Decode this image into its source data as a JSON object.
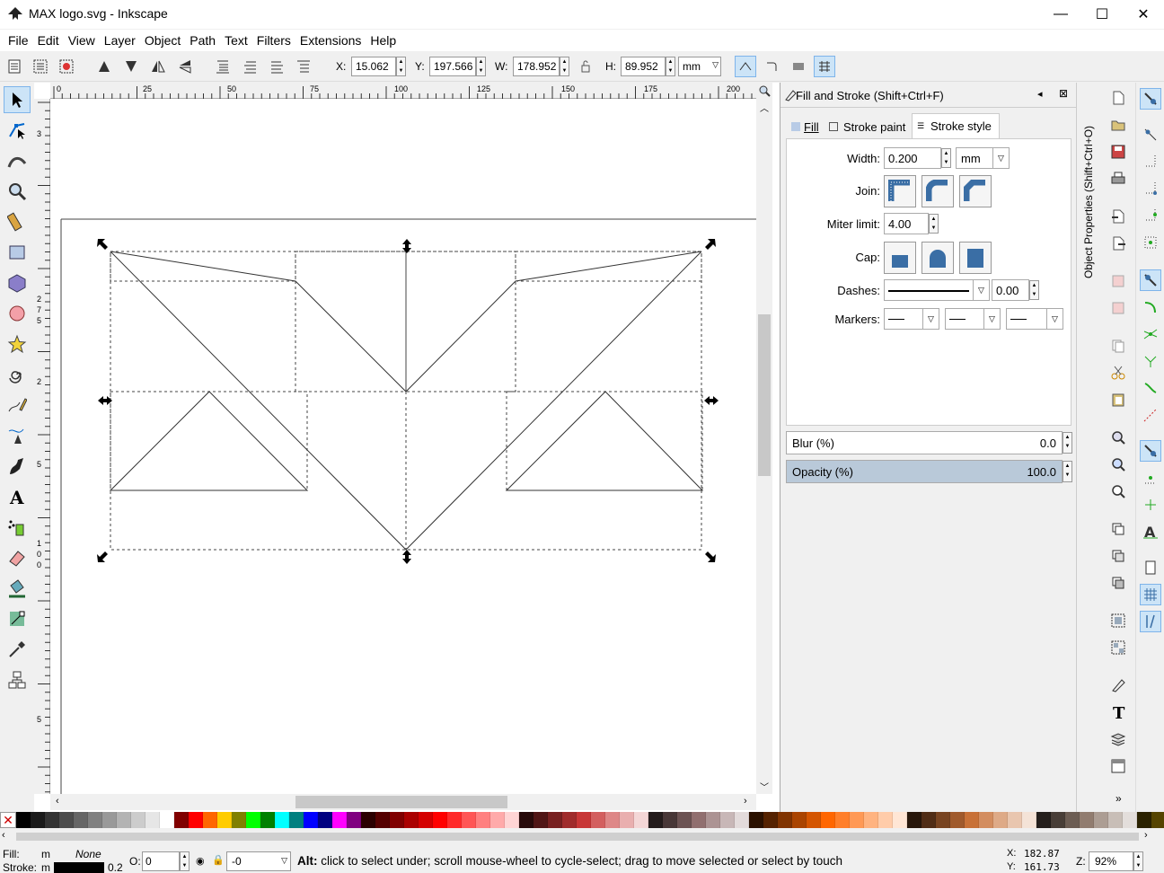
{
  "window": {
    "title": "MAX logo.svg - Inkscape",
    "minimize": "—",
    "maximize": "☐",
    "close": "✕"
  },
  "menu": [
    "File",
    "Edit",
    "View",
    "Layer",
    "Object",
    "Path",
    "Text",
    "Filters",
    "Extensions",
    "Help"
  ],
  "toolbar": {
    "x_label": "X:",
    "x_value": "15.062",
    "y_label": "Y:",
    "y_value": "197.566",
    "w_label": "W:",
    "w_value": "178.952",
    "h_label": "H:",
    "h_value": "89.952",
    "unit": "mm"
  },
  "ruler": {
    "h_ticks": [
      "0",
      "25",
      "50",
      "75",
      "100",
      "125",
      "150",
      "175",
      "200"
    ],
    "v_ticks": [
      "3",
      "2",
      "7",
      "5",
      "2",
      "5",
      "1",
      "0",
      "0",
      "5"
    ]
  },
  "dialog": {
    "title": "Fill and Stroke (Shift+Ctrl+F)",
    "tabs": [
      "Fill",
      "Stroke paint",
      "Stroke style"
    ],
    "active_tab": "Stroke style",
    "width_label": "Width:",
    "width_value": "0.200",
    "width_unit": "mm",
    "join_label": "Join:",
    "miter_label": "Miter limit:",
    "miter_value": "4.00",
    "cap_label": "Cap:",
    "dashes_label": "Dashes:",
    "dashes_offset": "0.00",
    "markers_label": "Markers:",
    "blur_label": "Blur (%)",
    "blur_value": "0.0",
    "opacity_label": "Opacity (%)",
    "opacity_value": "100.0",
    "opacity_fraction": 1.0
  },
  "side_tab": {
    "label": "Object Properties (Shift+Ctrl+O)"
  },
  "palette": {
    "none_swatch": "✕",
    "colors": [
      "#000000",
      "#1a1a1a",
      "#333333",
      "#4d4d4d",
      "#666666",
      "#808080",
      "#999999",
      "#b3b3b3",
      "#cccccc",
      "#e6e6e6",
      "#ffffff",
      "#800000",
      "#ff0000",
      "#ff6600",
      "#ffcc00",
      "#808000",
      "#00ff00",
      "#008000",
      "#00ffff",
      "#008080",
      "#0000ff",
      "#000080",
      "#ff00ff",
      "#800080",
      "#2b0000",
      "#550000",
      "#800000",
      "#aa0000",
      "#d40000",
      "#ff0000",
      "#ff2a2a",
      "#ff5555",
      "#ff8080",
      "#ffaaaa",
      "#ffd5d5",
      "#280b0b",
      "#501616",
      "#782121",
      "#a02c2c",
      "#c83737",
      "#d35f5f",
      "#de8787",
      "#e9afaf",
      "#f4d7d7",
      "#241c1c",
      "#483737",
      "#6c5353",
      "#916f6f",
      "#ac9393",
      "#c8b7b7",
      "#e3dbdb",
      "#2b1100",
      "#552200",
      "#803300",
      "#aa4400",
      "#d45500",
      "#ff6600",
      "#ff7f2a",
      "#ff9955",
      "#ffb380",
      "#ffccaa",
      "#ffe6d5",
      "#28170b",
      "#502d16",
      "#784421",
      "#a05a2c",
      "#c87137",
      "#d38d5f",
      "#deaa87",
      "#e9c6af",
      "#f4e3d7",
      "#241f1c",
      "#483e37",
      "#6c5d53",
      "#917c6f",
      "#ac9d93",
      "#c8beb7",
      "#e3dedb",
      "#2b2200",
      "#554400"
    ]
  },
  "status": {
    "fill_label": "Fill:",
    "fill_value": "m",
    "fill_none": "None",
    "stroke_label": "Stroke:",
    "stroke_value": "m",
    "stroke_width": "0.2",
    "opacity_label": "O:",
    "opacity_value": "0",
    "layer_value": "-0",
    "message": "Alt: click to select under; scroll mouse-wheel to cycle-select; drag to move selected or select by touch",
    "x_label": "X:",
    "x_value": "182.87",
    "y_label": "Y:",
    "y_value": "161.73",
    "zoom_label": "Z:",
    "zoom_value": "92%"
  },
  "accent": "#7eb4ea"
}
